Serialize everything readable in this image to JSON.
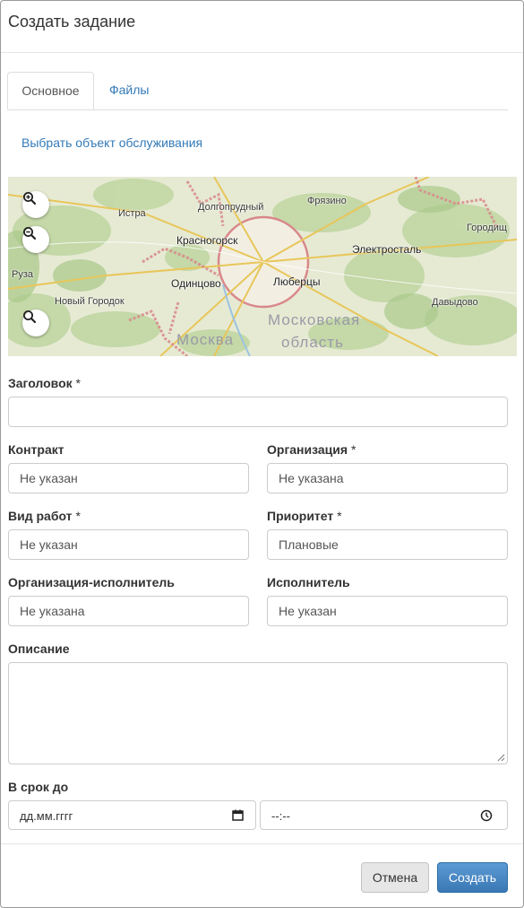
{
  "dialog": {
    "title": "Создать задание"
  },
  "tabs": [
    {
      "label": "Основное",
      "active": true
    },
    {
      "label": "Файлы",
      "active": false
    }
  ],
  "select_object_link": "Выбрать объект обслуживания",
  "map": {
    "labels": [
      "Долгопрудный",
      "Фрязино",
      "Истра",
      "Красногорск",
      "Электросталь",
      "Городищ",
      "Руза",
      "Одинцово",
      "Люберцы",
      "Новый Городок",
      "Давыдово",
      "Московская",
      "область",
      "Москва"
    ],
    "controls": [
      "zoom-in-icon",
      "zoom-out-icon",
      "search-icon"
    ]
  },
  "form": {
    "title_field": {
      "label": "Заголовок",
      "required_mark": "*",
      "value": ""
    },
    "contract": {
      "label": "Контракт",
      "value": "Не указан"
    },
    "organization": {
      "label": "Организация",
      "required_mark": "*",
      "value": "Не указана"
    },
    "work_type": {
      "label": "Вид работ",
      "required_mark": "*",
      "value": "Не указан"
    },
    "priority": {
      "label": "Приоритет",
      "required_mark": "*",
      "value": "Плановые"
    },
    "executor_org": {
      "label": "Организация-исполнитель",
      "value": "Не указана"
    },
    "executor": {
      "label": "Исполнитель",
      "value": "Не указан"
    },
    "description": {
      "label": "Описание",
      "value": ""
    },
    "deadline": {
      "label": "В срок до",
      "date_placeholder": "дд.мм.гггг",
      "time_placeholder": "--:--"
    }
  },
  "buttons": {
    "cancel": "Отмена",
    "create": "Создать"
  },
  "colors": {
    "link": "#337ab7",
    "primary": "#3a78b5",
    "moscow_border": "#d9888a"
  }
}
